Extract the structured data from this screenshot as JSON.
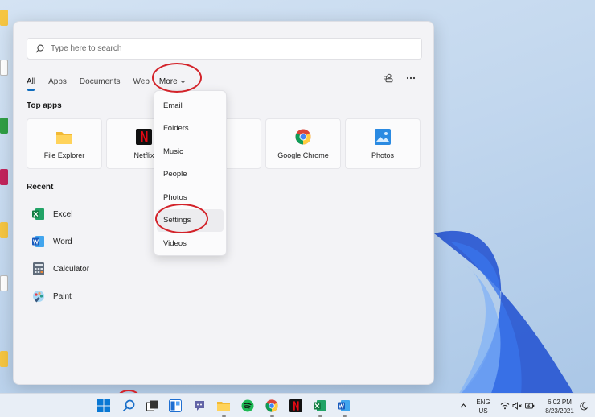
{
  "search": {
    "placeholder": "Type here to search"
  },
  "tabs": [
    {
      "label": "All"
    },
    {
      "label": "Apps"
    },
    {
      "label": "Documents"
    },
    {
      "label": "Web"
    },
    {
      "label": "More"
    }
  ],
  "sections": {
    "top_apps": "Top apps",
    "recent": "Recent"
  },
  "top_apps": [
    {
      "label": "File Explorer",
      "icon": "folder-icon"
    },
    {
      "label": "Netflix",
      "icon": "netflix-icon"
    },
    {
      "label": "",
      "icon": "app-icon"
    },
    {
      "label": "Google Chrome",
      "icon": "chrome-icon"
    },
    {
      "label": "Photos",
      "icon": "photos-icon"
    }
  ],
  "recent": [
    {
      "label": "Excel",
      "icon": "excel-icon"
    },
    {
      "label": "Word",
      "icon": "word-icon"
    },
    {
      "label": "Calculator",
      "icon": "calculator-icon"
    },
    {
      "label": "Paint",
      "icon": "paint-icon"
    }
  ],
  "more_menu": [
    {
      "label": "Email"
    },
    {
      "label": "Folders"
    },
    {
      "label": "Music"
    },
    {
      "label": "People"
    },
    {
      "label": "Photos"
    },
    {
      "label": "Settings"
    },
    {
      "label": "Videos"
    }
  ],
  "tray": {
    "lang_1": "ENG",
    "lang_2": "US",
    "time": "6:02 PM",
    "date": "8/23/2021"
  },
  "colors": {
    "accent": "#0f6cbd",
    "annotation": "#d3232a"
  }
}
